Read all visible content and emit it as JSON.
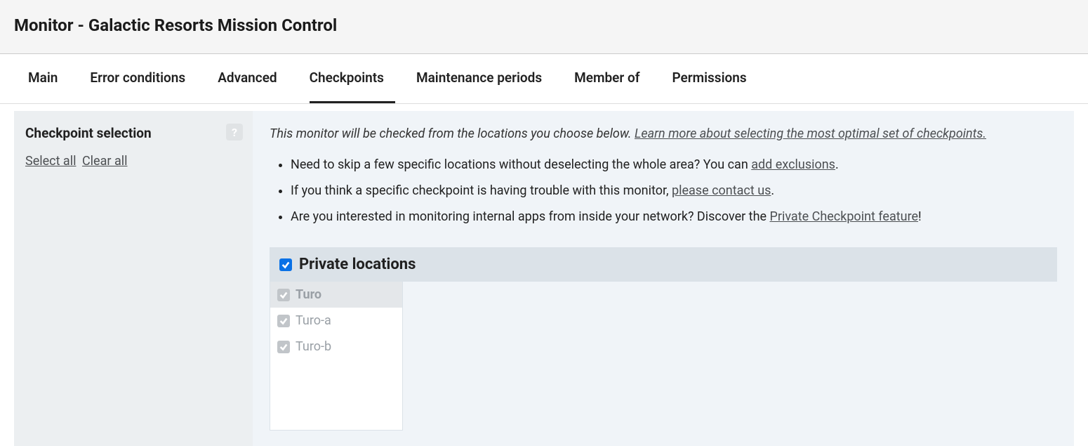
{
  "header": {
    "title": "Monitor - Galactic Resorts Mission Control"
  },
  "tabs": [
    {
      "label": "Main",
      "active": false
    },
    {
      "label": "Error conditions",
      "active": false
    },
    {
      "label": "Advanced",
      "active": false
    },
    {
      "label": "Checkpoints",
      "active": true
    },
    {
      "label": "Maintenance periods",
      "active": false
    },
    {
      "label": "Member of",
      "active": false
    },
    {
      "label": "Permissions",
      "active": false
    }
  ],
  "sidebar": {
    "title": "Checkpoint selection",
    "select_all": "Select all",
    "clear_all": "Clear all",
    "help_glyph": "?"
  },
  "main": {
    "intro_text": "This monitor will be checked from the locations you choose below. ",
    "intro_link": "Learn more about selecting the most optimal set of checkpoints.",
    "bullet1_pre": "Need to skip a few specific locations without deselecting the whole area? You can ",
    "bullet1_link": "add exclusions",
    "bullet1_post": ".",
    "bullet2_pre": "If you think a specific checkpoint is having trouble with this monitor, ",
    "bullet2_link": "please contact us",
    "bullet2_post": ".",
    "bullet3_pre": "Are you interested in monitoring internal apps from inside your network? Discover the ",
    "bullet3_link": "Private Checkpoint feature",
    "bullet3_post": "!",
    "group_title": "Private locations",
    "items": [
      {
        "label": "Turo",
        "head": true
      },
      {
        "label": "Turo-a",
        "head": false
      },
      {
        "label": "Turo-b",
        "head": false
      }
    ]
  }
}
